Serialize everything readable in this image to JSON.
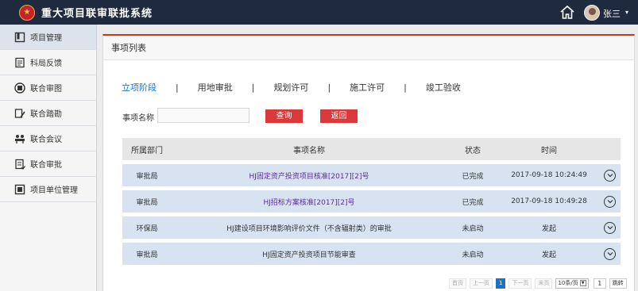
{
  "header": {
    "title": "重大项目联审联批系统",
    "user_name": "张三"
  },
  "sidebar": {
    "items": [
      {
        "label": "项目管理",
        "icon": "book-icon"
      },
      {
        "label": "科局反馈",
        "icon": "feedback-icon"
      },
      {
        "label": "联合审图",
        "icon": "review-icon"
      },
      {
        "label": "联合踏勘",
        "icon": "survey-icon"
      },
      {
        "label": "联合会议",
        "icon": "meeting-icon"
      },
      {
        "label": "联合审批",
        "icon": "approval-icon"
      },
      {
        "label": "项目单位管理",
        "icon": "org-icon"
      }
    ]
  },
  "panel": {
    "title": "事项列表"
  },
  "tabs": [
    {
      "label": "立项阶段"
    },
    {
      "label": "用地审批"
    },
    {
      "label": "规划许可"
    },
    {
      "label": "施工许可"
    },
    {
      "label": "竣工验收"
    }
  ],
  "tab_separator": "|",
  "search": {
    "label": "事项名称",
    "value": "",
    "query_button": "查询",
    "back_button": "返回"
  },
  "table": {
    "headers": [
      "所属部门",
      "事项名称",
      "状态",
      "时间"
    ],
    "rows": [
      {
        "dept": "审批局",
        "name": "HJ固定资产投资项目核准[2017][2]号",
        "status": "已完成",
        "time": "2017-09-18 10:24:49"
      },
      {
        "dept": "审批局",
        "name": "HJ招标方案核准[2017][2]号",
        "status": "已完成",
        "time": "2017-09-18 10:49:28"
      },
      {
        "dept": "环保局",
        "name": "HJ建设项目环境影响评价文件（不含辐射类）的审批",
        "status": "未启动",
        "time": "发起"
      },
      {
        "dept": "审批局",
        "name": "HJ固定资产投资项目节能审查",
        "status": "未启动",
        "time": "发起"
      }
    ]
  },
  "pagination": {
    "first": "首页",
    "prev": "上一页",
    "current": "1",
    "next": "下一页",
    "last": "末页",
    "page_size": "10条/页",
    "goto_value": "1",
    "goto": "跳转"
  },
  "colors": {
    "topbar": "#1f2a3f",
    "accent_red": "#d9393a",
    "row_bg": "#d7e3f1",
    "active_tab": "#1a73c8",
    "link": "#5b2b9a"
  }
}
